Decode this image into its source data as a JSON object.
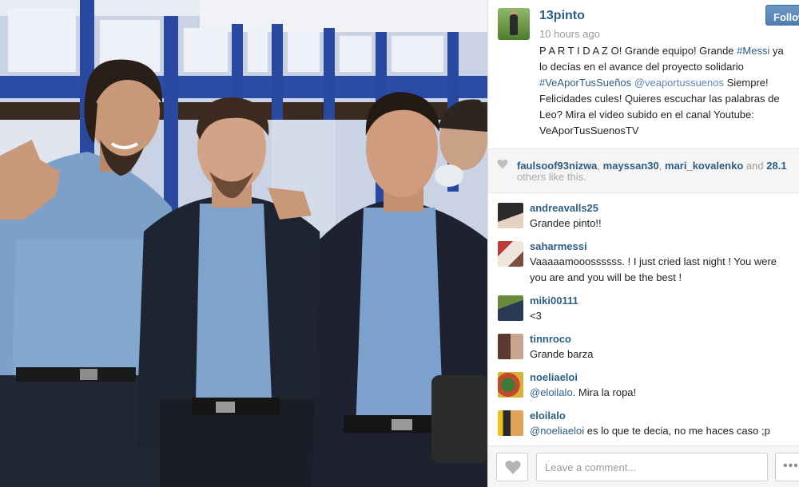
{
  "post": {
    "username": "13pinto",
    "timestamp": "10 hours ago",
    "follow_label": "Follow",
    "caption": {
      "line1": "P A R T I D A Z O! Grande equipo! Grande ",
      "tag1": "#Messi",
      "line1_rest": " ya",
      "line2": "lo decías en el avance del proyecto solidario",
      "tag2": "#VeAporTusSueños",
      "mention1": "@veaportussuenos",
      "line3_rest": " Siempre!",
      "line4": "Felicidades cules! Quieres escuchar las palabras de",
      "line5": "Leo? Mira el video subido en el canal Youtube:",
      "line6": "VeAporTusSuenosTV"
    }
  },
  "likes": {
    "user1": "faulsoof93nizwa",
    "user2": "mayssan30",
    "user3": "mari_kovalenko",
    "and_text": "and",
    "count": "28.1",
    "others_text": "others like this."
  },
  "comments": [
    {
      "user": "andreavalls25",
      "text": "Grandee pinto!!"
    },
    {
      "user": "saharmessi",
      "text": "Vaaaaamooossssss. ! I just cried last night ! You were",
      "text2": "you are and you will be the best !"
    },
    {
      "user": "miki00111",
      "text": "<3"
    },
    {
      "user": "tinnroco",
      "text": "Grande barza"
    },
    {
      "user": "noeliaeloi",
      "mention": "@eloilalo",
      "text": ". Mira la ropa!"
    },
    {
      "user": "eloilalo",
      "mention": "@noeliaeloi",
      "text": " es lo que te decia, no me haces caso ;p"
    }
  ],
  "footer": {
    "comment_placeholder": "Leave a comment...",
    "more_label": "•••"
  },
  "icons": {
    "like": "heart-icon",
    "more": "more-dots-icon"
  },
  "colors": {
    "link": "#2e5e86",
    "follow_button": "#5a8abc"
  }
}
